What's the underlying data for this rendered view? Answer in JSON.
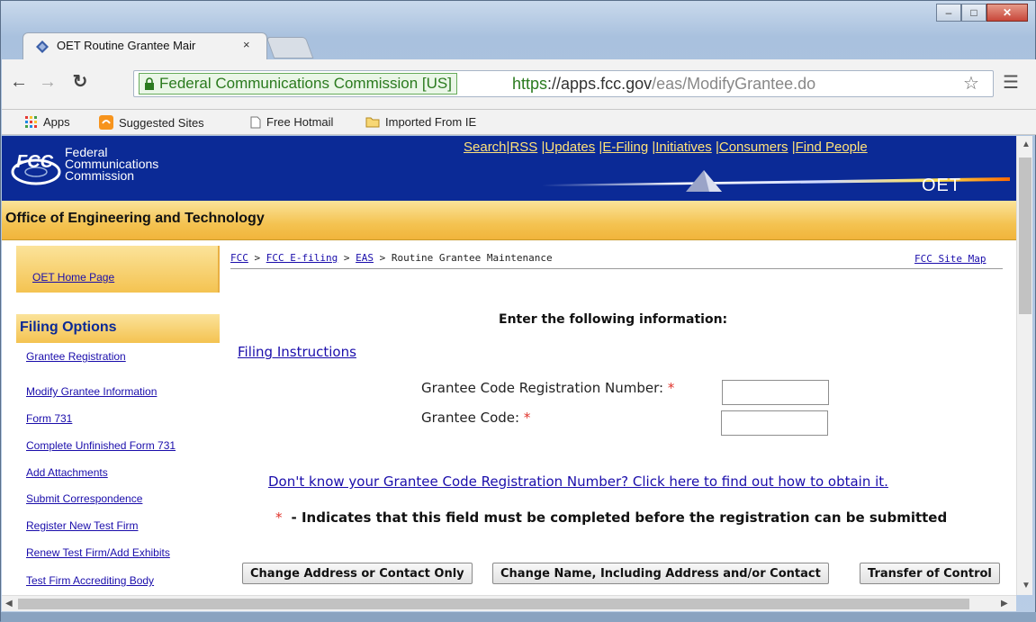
{
  "browser": {
    "tab_title": "OET Routine Grantee Mair",
    "tab_close": "×",
    "ev_label": "Federal Communications Commission [US]",
    "url_scheme": "https",
    "url_host": "://apps.fcc.gov",
    "url_path": "/eas/ModifyGrantee.do",
    "bookmarks": [
      "Apps",
      "Suggested Sites",
      "Free Hotmail",
      "Imported From IE"
    ],
    "icons": [
      "back-icon",
      "forward-icon",
      "reload-icon",
      "lock-icon",
      "star-icon",
      "menu-icon"
    ]
  },
  "header": {
    "logo_text": "FCC",
    "agency_line1": "Federal",
    "agency_line2": "Communications",
    "agency_line3": "Commission",
    "top_links": [
      "Search",
      "RSS",
      "Updates",
      "E-Filing",
      "Initiatives",
      "Consumers",
      "Find People"
    ],
    "oet_mark": "OET",
    "office_title": "Office of Engineering and Technology"
  },
  "sidebar": {
    "home_link": "OET Home Page",
    "section_title": "Filing Options",
    "items": [
      "Grantee Registration",
      "Modify Grantee Information",
      "Form 731",
      "Complete Unfinished Form 731",
      "Add Attachments",
      "Submit Correspondence",
      "Register New Test Firm",
      "Renew Test Firm/Add Exhibits",
      "Test Firm Accrediting Body"
    ]
  },
  "main": {
    "breadcrumb": [
      "FCC",
      "FCC E-filing",
      "EAS",
      "Routine Grantee Maintenance"
    ],
    "breadcrumb_sep": " > ",
    "site_map": "FCC Site Map",
    "prompt": "Enter the following information:",
    "filing_instructions": "Filing Instructions",
    "fields": [
      {
        "label": "Grantee Code Registration Number:",
        "value": ""
      },
      {
        "label": "Grantee Code:",
        "value": ""
      }
    ],
    "required_mark": "*",
    "help_link": "Don't know your Grantee Code Registration Number? Click here to find out how to obtain it.",
    "legend_text": "- Indicates that this field must be completed before the registration can be submitted",
    "buttons": [
      "Change Address or Contact Only",
      "Change Name, Including Address and/or Contact",
      "Transfer of Control"
    ]
  },
  "colors": {
    "fcc_blue": "#0b2a96",
    "gold": "#f4c351",
    "link": "#1a0dab",
    "required": "#e0332b"
  }
}
